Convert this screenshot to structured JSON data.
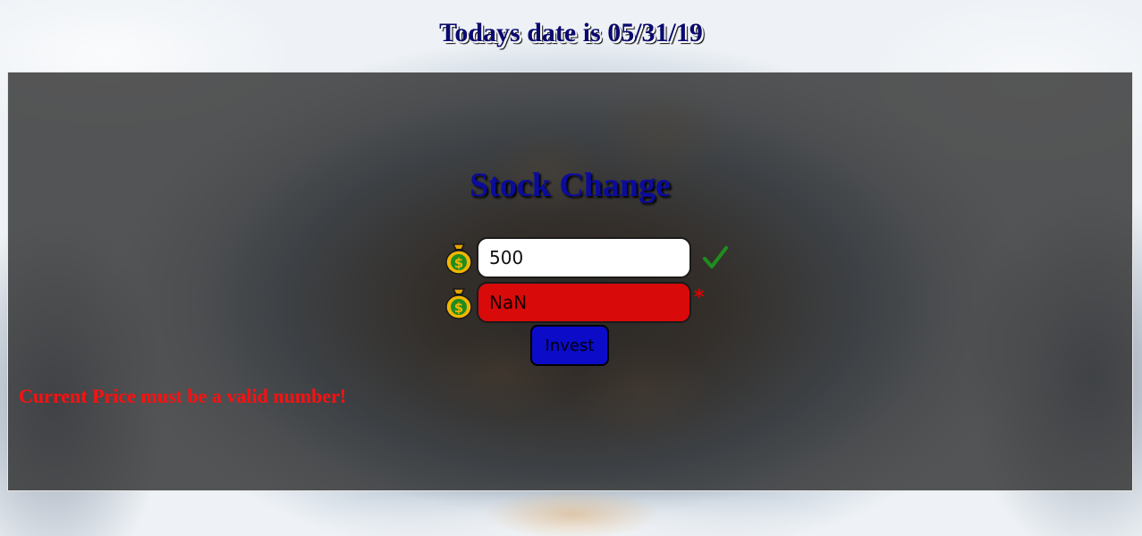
{
  "header": {
    "date_text": "Todays date is 05/31/19"
  },
  "form": {
    "title": "Stock Change",
    "shares": {
      "value": "500",
      "icon": "money-bag-icon",
      "status_icon": "check-icon"
    },
    "current_price": {
      "value": "NaN",
      "icon": "money-bag-icon",
      "required_mark": "*"
    },
    "submit_label": "Invest",
    "error_message": "Current Price must be a valid number!"
  },
  "colors": {
    "title_blue": "#0b0b9c",
    "invalid_field": "#d90a0a",
    "button_blue": "#0b0bc8",
    "error_red": "#ff1010",
    "check_green": "#1e8c1e"
  }
}
